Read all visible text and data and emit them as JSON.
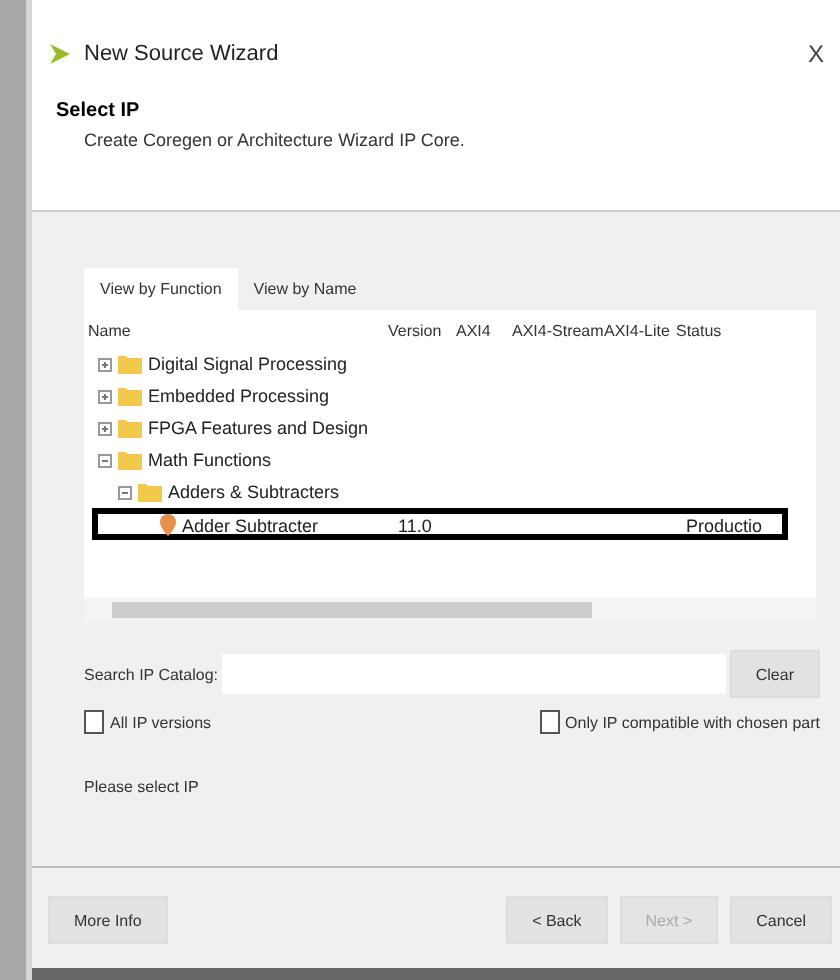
{
  "window": {
    "title": "New Source Wizard",
    "close": "X"
  },
  "header": {
    "title": "Select IP",
    "subtitle": "Create Coregen or Architecture Wizard IP Core."
  },
  "tabs": [
    {
      "label": "View by Function",
      "selected": true
    },
    {
      "label": "View by Name",
      "selected": false
    }
  ],
  "table": {
    "columns": [
      "Name",
      "Version",
      "AXI4",
      "AXI4-Stream",
      "AXI4-Lite",
      "Status"
    ],
    "tree": [
      {
        "name": "Digital Signal Processing",
        "kind": "folder",
        "expanded": false
      },
      {
        "name": "Embedded Processing",
        "kind": "folder",
        "expanded": false
      },
      {
        "name": "FPGA Features and Design",
        "kind": "folder",
        "expanded": false
      },
      {
        "name": "Math Functions",
        "kind": "folder",
        "expanded": true,
        "children": [
          {
            "name": "Adders & Subtracters",
            "kind": "folder",
            "expanded": true,
            "children": [
              {
                "name": "Adder Subtracter",
                "kind": "core",
                "version": "11.0",
                "status": "Productio",
                "highlighted": true
              }
            ]
          }
        ]
      }
    ]
  },
  "search": {
    "label": "Search IP Catalog:",
    "button": "Clear"
  },
  "options": [
    {
      "label": "All IP versions",
      "checked": false
    },
    {
      "label": "Only IP compatible with chosen part",
      "checked": false
    }
  ],
  "message": "Please select IP",
  "buttons": [
    {
      "label": "More Info",
      "disabled": false
    },
    {
      "label": "< Back",
      "disabled": false
    },
    {
      "label": "Next >",
      "disabled": true
    },
    {
      "label": "Cancel",
      "disabled": false
    }
  ]
}
